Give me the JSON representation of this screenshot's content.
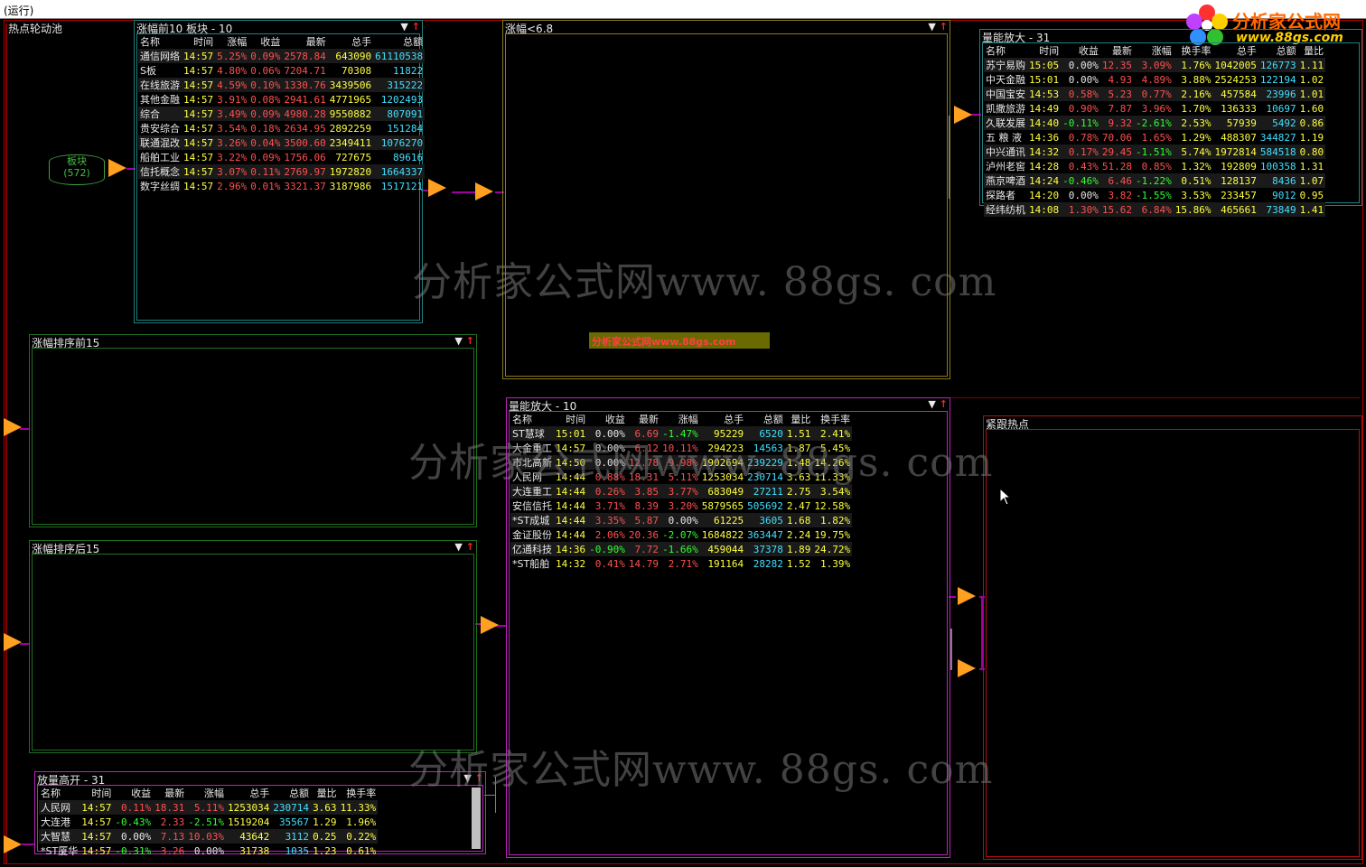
{
  "window": {
    "title": "(运行)"
  },
  "workspace": {
    "title": "热点轮动池"
  },
  "logo": {
    "line1": "分析家公式网",
    "line2": "www.88gs.com"
  },
  "watermark": "分析家公式网www. 88gs. com",
  "banner": "分析家公式网www.88gs.com",
  "db_node": {
    "label": "板块",
    "count": "(572)"
  },
  "panels": {
    "top10": {
      "title": "涨幅前10   板块 - 10",
      "columns": [
        "名称",
        "时间",
        "涨幅",
        "收益",
        "最新",
        "总手",
        "总额"
      ],
      "rows": [
        [
          "通信网络",
          "14:57",
          "5.25%",
          "0.09%",
          "2578.84",
          "643090",
          "61110538"
        ],
        [
          "S板",
          "14:57",
          "4.80%",
          "0.06%",
          "7204.71",
          "70308",
          "11822"
        ],
        [
          "在线旅游",
          "14:57",
          "4.59%",
          "0.10%",
          "1330.76",
          "3439506",
          "315222"
        ],
        [
          "其他金融",
          "14:57",
          "3.91%",
          "0.08%",
          "2941.61",
          "4771965",
          "1202493"
        ],
        [
          "综合",
          "14:57",
          "3.49%",
          "0.09%",
          "4980.28",
          "9550882",
          "807091"
        ],
        [
          "贵安综合",
          "14:57",
          "3.54%",
          "0.18%",
          "2634.95",
          "2892259",
          "151284"
        ],
        [
          "联通混改",
          "14:57",
          "3.26%",
          "0.04%",
          "3500.60",
          "2349411",
          "1076270"
        ],
        [
          "船舶工业",
          "14:57",
          "3.22%",
          "0.09%",
          "1756.06",
          "727675",
          "89616"
        ],
        [
          "信托概念",
          "14:57",
          "3.07%",
          "0.11%",
          "2769.97",
          "1972820",
          "1664337"
        ],
        [
          "数字丝绸",
          "14:57",
          "2.96%",
          "0.01%",
          "3321.37",
          "3187986",
          "1517121"
        ]
      ]
    },
    "lt68": {
      "title": "涨幅<6.8"
    },
    "vol31": {
      "title": "量能放大 - 31",
      "columns": [
        "名称",
        "时间",
        "收益",
        "最新",
        "涨幅",
        "换手率",
        "总手",
        "总额",
        "量比"
      ],
      "rows": [
        [
          "苏宁易购",
          "15:05",
          "0.00%",
          "12.35",
          "3.09%",
          "1.76%",
          "1042005",
          "126773",
          "1.11"
        ],
        [
          "中天金融",
          "15:01",
          "0.00%",
          "4.93",
          "4.89%",
          "3.88%",
          "2524253",
          "122194",
          "1.02"
        ],
        [
          "中国宝安",
          "14:53",
          "0.58%",
          "5.23",
          "0.77%",
          "2.16%",
          "457584",
          "23996",
          "1.01"
        ],
        [
          "凯撒旅游",
          "14:49",
          "0.90%",
          "7.87",
          "3.96%",
          "1.70%",
          "136333",
          "10697",
          "1.60"
        ],
        [
          "久联发展",
          "14:40",
          "-0.11%",
          "9.32",
          "-2.61%",
          "2.53%",
          "57939",
          "5492",
          "0.86"
        ],
        [
          "五 粮 液",
          "14:36",
          "0.78%",
          "70.06",
          "1.65%",
          "1.29%",
          "488307",
          "344827",
          "1.19"
        ],
        [
          "中兴通讯",
          "14:32",
          "0.17%",
          "29.45",
          "-1.51%",
          "5.74%",
          "1972814",
          "584518",
          "0.80"
        ],
        [
          "泸州老窖",
          "14:28",
          "0.43%",
          "51.28",
          "0.85%",
          "1.32%",
          "192809",
          "100358",
          "1.31"
        ],
        [
          "燕京啤酒",
          "14:24",
          "-0.46%",
          "6.46",
          "-1.22%",
          "0.51%",
          "128137",
          "8436",
          "1.07"
        ],
        [
          "探路者",
          "14:20",
          "0.00%",
          "3.82",
          "-1.55%",
          "3.53%",
          "233457",
          "9012",
          "0.95"
        ],
        [
          "经纬纺机",
          "14:08",
          "1.30%",
          "15.62",
          "6.84%",
          "15.86%",
          "465661",
          "73849",
          "1.41"
        ]
      ]
    },
    "sortTop15": {
      "title": "涨幅排序前15"
    },
    "sortBottom15": {
      "title": "涨幅排序后15"
    },
    "vol10": {
      "title": "量能放大 - 10",
      "columns": [
        "名称",
        "时间",
        "收益",
        "最新",
        "涨幅",
        "总手",
        "总额",
        "量比",
        "换手率"
      ],
      "rows": [
        [
          "ST慧球",
          "15:01",
          "0.00%",
          "6.69",
          "-1.47%",
          "95229",
          "6520",
          "1.51",
          "2.41%"
        ],
        [
          "大金重工",
          "14:57",
          "0.00%",
          "6.12",
          "10.11%",
          "294223",
          "14563",
          "1.87",
          "5.45%"
        ],
        [
          "市北高新",
          "14:50",
          "0.00%",
          "12.78",
          "9.98%",
          "1902694",
          "239229",
          "1.48",
          "14.26%"
        ],
        [
          "人民网",
          "14:44",
          "0.88%",
          "18.31",
          "5.11%",
          "1253034",
          "230714",
          "3.63",
          "11.33%"
        ],
        [
          "大连重工",
          "14:44",
          "0.26%",
          "3.85",
          "3.77%",
          "683049",
          "27211",
          "2.75",
          "3.54%"
        ],
        [
          "安信信托",
          "14:44",
          "3.71%",
          "8.39",
          "3.20%",
          "5879565",
          "505692",
          "2.47",
          "12.58%"
        ],
        [
          "*ST成城",
          "14:44",
          "3.35%",
          "5.87",
          "0.00%",
          "61225",
          "3605",
          "1.68",
          "1.82%"
        ],
        [
          "金证股份",
          "14:44",
          "2.06%",
          "20.36",
          "-2.07%",
          "1684822",
          "363447",
          "2.24",
          "19.75%"
        ],
        [
          "亿通科技",
          "14:36",
          "-0.90%",
          "7.72",
          "-1.66%",
          "459044",
          "37378",
          "1.89",
          "24.72%"
        ],
        [
          "*ST船舶",
          "14:32",
          "0.41%",
          "14.79",
          "2.71%",
          "191164",
          "28282",
          "1.52",
          "1.39%"
        ]
      ]
    },
    "track": {
      "title": "紧跟热点"
    },
    "gapup": {
      "title": "放量高开 - 31",
      "columns": [
        "名称",
        "时间",
        "收益",
        "最新",
        "涨幅",
        "总手",
        "总额",
        "量比",
        "换手率"
      ],
      "rows": [
        [
          "人民网",
          "14:57",
          "0.11%",
          "18.31",
          "5.11%",
          "1253034",
          "230714",
          "3.63",
          "11.33%"
        ],
        [
          "大连港",
          "14:57",
          "-0.43%",
          "2.33",
          "-2.51%",
          "1519204",
          "35567",
          "1.29",
          "1.96%"
        ],
        [
          "大智慧",
          "14:57",
          "0.00%",
          "7.13",
          "10.03%",
          "43642",
          "3112",
          "0.25",
          "0.22%"
        ],
        [
          "*ST厦华",
          "14:57",
          "-0.31%",
          "3.26",
          "0.00%",
          "31738",
          "1035",
          "1.23",
          "0.61%"
        ]
      ]
    }
  },
  "colors": {
    "up": "#ff5050",
    "down": "#30ff30",
    "flat": "#e8e8e8",
    "time": "#ffff40",
    "amount": "#40e0ff",
    "node": "#ffa020",
    "wire": "#a000a0"
  }
}
